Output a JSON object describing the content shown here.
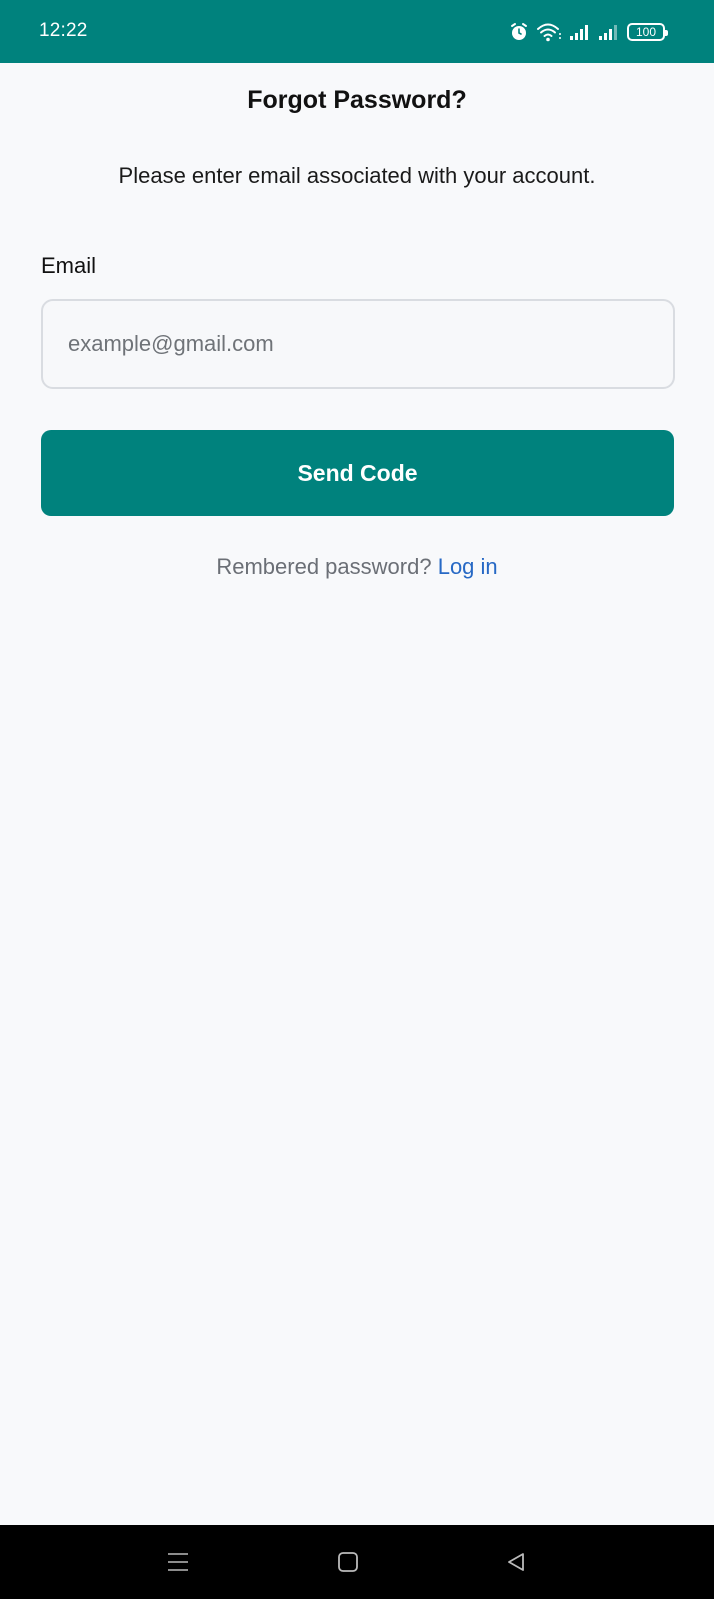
{
  "status_bar": {
    "time": "12:22",
    "battery": "100",
    "icons": [
      "alarm-icon",
      "wifi-icon",
      "signal-icon",
      "signal-icon",
      "battery-icon"
    ],
    "background": "#00827d"
  },
  "page": {
    "title": "Forgot Password?",
    "subtitle": "Please enter email associated with your account."
  },
  "form": {
    "email_label": "Email",
    "email_placeholder": "example@gmail.com",
    "email_value": "",
    "submit_label": "Send Code"
  },
  "footer": {
    "prompt": "Rembered password?",
    "link_label": "Log in"
  },
  "nav_bar": {
    "icons": [
      "menu-icon",
      "home-icon",
      "back-icon"
    ]
  },
  "colors": {
    "accent": "#00827d",
    "link": "#2769c5",
    "background": "#f8f9fb"
  }
}
